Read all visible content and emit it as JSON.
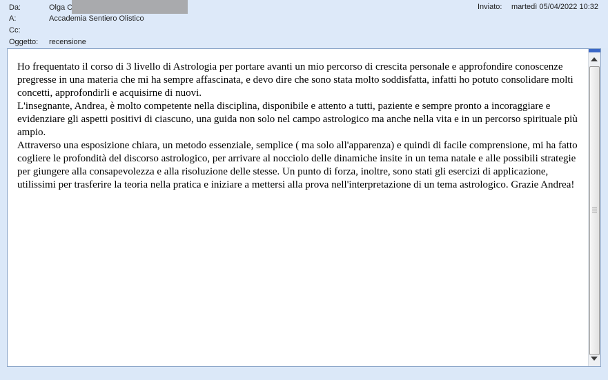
{
  "header": {
    "from_label": "Da:",
    "from_value": "Olga O",
    "to_label": "A:",
    "to_value": "Accademia Sentiero Olistico",
    "cc_label": "Cc:",
    "cc_value": "",
    "subject_label": "Oggetto:",
    "subject_value": "recensione",
    "sent_label": "Inviato:",
    "sent_value": "martedì 05/04/2022 10:32"
  },
  "message": {
    "paragraphs": [
      "Ho frequentato il corso di 3 livello di Astrologia per portare avanti  un mio percorso di crescita personale e approfondire conoscenze pregresse in una materia che mi ha sempre affascinata, e devo dire che sono stata molto soddisfatta, infatti ho potuto consolidare molti concetti, approfondirli e acquisirne di nuovi.",
      "L'insegnante, Andrea, è molto competente nella disciplina, disponibile e attento a tutti, paziente e sempre pronto a incoraggiare e evidenziare gli aspetti positivi di ciascuno, una guida non solo nel campo astrologico ma anche nella vita e in un percorso spirituale più ampio.",
      "Attraverso una esposizione chiara, un metodo essenziale, semplice ( ma solo all'apparenza) e quindi di facile comprensione, mi ha fatto cogliere le profondità del discorso astrologico, per arrivare al nocciolo delle dinamiche insite in un tema natale e alle possibili strategie per giungere alla consapevolezza e alla risoluzione delle stesse. Un punto di forza, inoltre,  sono stati gli esercizi di applicazione,  utilissimi per trasferire la teoria nella pratica e iniziare a mettersi alla prova nell'interpretazione di un tema astrologico. Grazie Andrea!"
    ]
  },
  "colors": {
    "header_bg": "#dde9f9",
    "frame_border": "#8aa5c8",
    "scroll_accent": "#3b68c7"
  },
  "icons": [
    "scroll-up-arrow-icon",
    "scroll-down-arrow-icon",
    "scroll-grip-icon"
  ]
}
